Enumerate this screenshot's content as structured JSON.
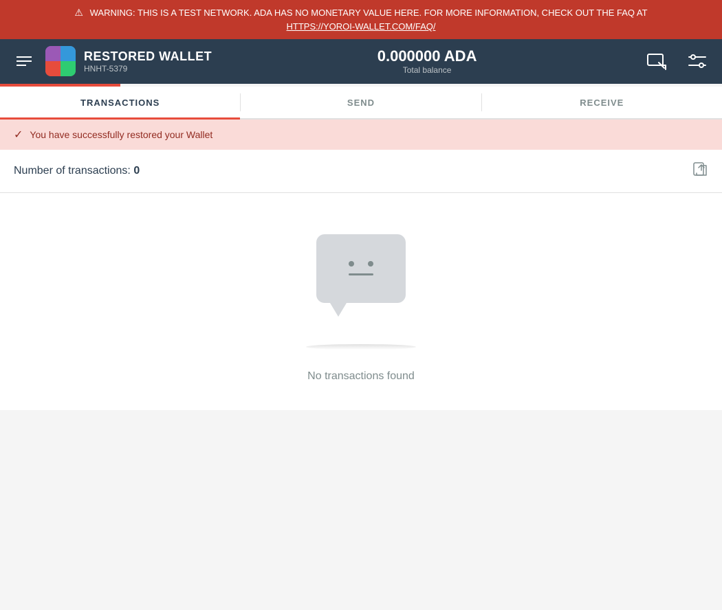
{
  "warning": {
    "text": "WARNING: THIS IS A TEST NETWORK. ADA HAS NO MONETARY VALUE HERE. FOR MORE INFORMATION, CHECK OUT THE FAQ AT",
    "link_text": "HTTPS://YOROI-WALLET.COM/FAQ/",
    "link_url": "https://yoroi-wallet.com/faq/"
  },
  "header": {
    "wallet_name": "RESTORED WALLET",
    "wallet_id": "HNHT-5379",
    "balance": "0.000000 ADA",
    "balance_label": "Total balance"
  },
  "tabs": [
    {
      "label": "TRANSACTIONS",
      "active": true
    },
    {
      "label": "SEND",
      "active": false
    },
    {
      "label": "RECEIVE",
      "active": false
    }
  ],
  "success_message": "You have successfully restored your Wallet",
  "transactions": {
    "count_label": "Number of transactions:",
    "count": "0",
    "empty_message": "No transactions found"
  }
}
